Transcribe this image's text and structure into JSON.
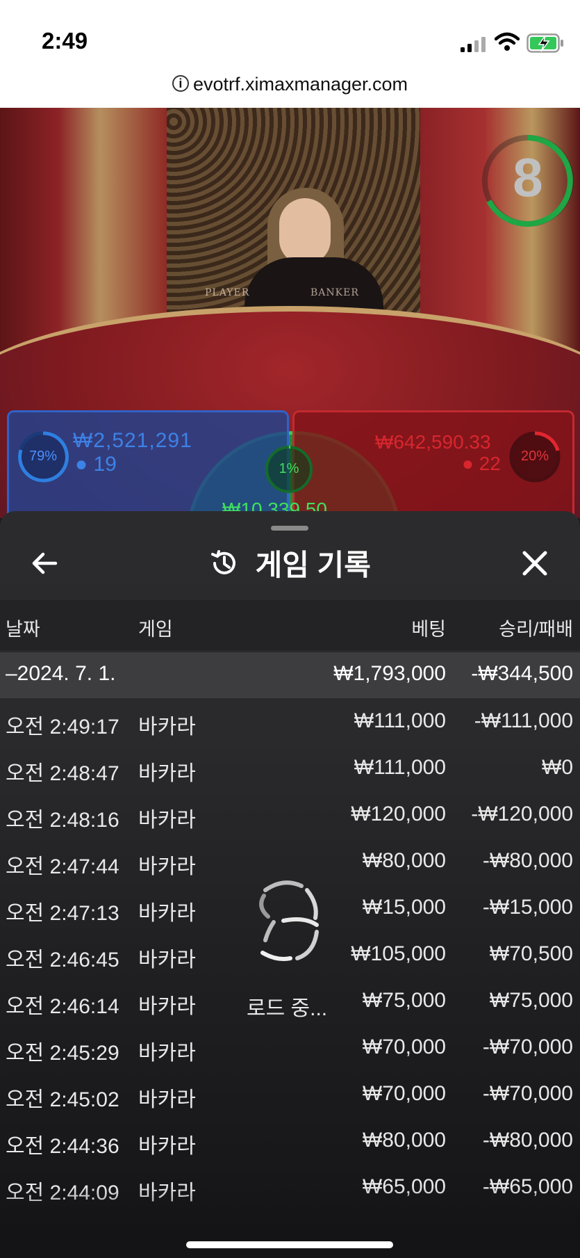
{
  "status_bar": {
    "time": "2:49",
    "url": "evotrf.ximaxmanager.com"
  },
  "game_view": {
    "timer": "8",
    "table_labels": {
      "player": "PLAYER",
      "banker": "BANKER"
    },
    "player": {
      "percent": "79%",
      "amount": "₩2,521,291",
      "count": "19",
      "color": "#3d82e6"
    },
    "banker": {
      "percent": "20%",
      "amount": "₩642,590.33",
      "count": "22",
      "color": "#d8262e"
    },
    "tie": {
      "percent": "1%",
      "amount": "₩10,339.50",
      "color": "#3fe05f"
    }
  },
  "sheet": {
    "title": "게임 기록",
    "icons": {
      "back": "arrow-left-icon",
      "history": "history-icon",
      "close": "close-icon"
    },
    "columns": {
      "date": "날짜",
      "game": "게임",
      "bet": "베팅",
      "result": "승리/패배"
    },
    "date_group": {
      "date": "–2024. 7. 1.",
      "bet_total": "₩1,793,000",
      "result_total": "-₩344,500"
    },
    "rows": [
      {
        "time": "오전 2:49:17",
        "game": "바카라",
        "bet": "₩111,000",
        "result": "-₩111,000"
      },
      {
        "time": "오전 2:48:47",
        "game": "바카라",
        "bet": "₩111,000",
        "result": "₩0"
      },
      {
        "time": "오전 2:48:16",
        "game": "바카라",
        "bet": "₩120,000",
        "result": "-₩120,000"
      },
      {
        "time": "오전 2:47:44",
        "game": "바카라",
        "bet": "₩80,000",
        "result": "-₩80,000"
      },
      {
        "time": "오전 2:47:13",
        "game": "바카라",
        "bet": "₩15,000",
        "result": "-₩15,000"
      },
      {
        "time": "오전 2:46:45",
        "game": "바카라",
        "bet": "₩105,000",
        "result": "₩70,500"
      },
      {
        "time": "오전 2:46:14",
        "game": "바카라",
        "bet": "₩75,000",
        "result": "₩75,000"
      },
      {
        "time": "오전 2:45:29",
        "game": "바카라",
        "bet": "₩70,000",
        "result": "-₩70,000"
      },
      {
        "time": "오전 2:45:02",
        "game": "바카라",
        "bet": "₩70,000",
        "result": "-₩70,000"
      },
      {
        "time": "오전 2:44:36",
        "game": "바카라",
        "bet": "₩80,000",
        "result": "-₩80,000"
      },
      {
        "time": "오전 2:44:09",
        "game": "바카라",
        "bet": "₩65,000",
        "result": "-₩65,000"
      }
    ],
    "loading_text": "로드 중..."
  }
}
